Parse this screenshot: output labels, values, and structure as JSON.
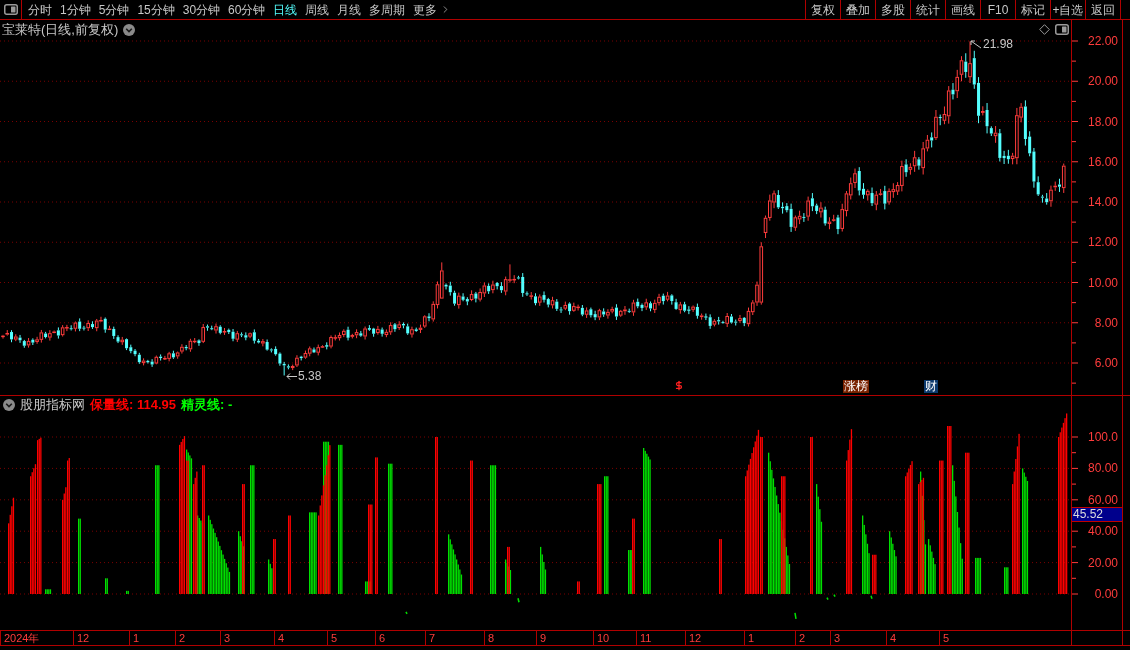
{
  "toolbar": {
    "periods": [
      {
        "label": "分时",
        "selected": false,
        "kind": "period"
      },
      {
        "label": "1分钟",
        "selected": false,
        "kind": "period"
      },
      {
        "label": "5分钟",
        "selected": false,
        "kind": "period"
      },
      {
        "label": "15分钟",
        "selected": false,
        "kind": "period"
      },
      {
        "label": "30分钟",
        "selected": false,
        "kind": "period"
      },
      {
        "label": "60分钟",
        "selected": false,
        "kind": "period"
      },
      {
        "label": "日线",
        "selected": true,
        "kind": "period"
      },
      {
        "label": "周线",
        "selected": false,
        "kind": "period"
      },
      {
        "label": "月线",
        "selected": false,
        "kind": "period"
      },
      {
        "label": "多周期",
        "selected": false,
        "kind": "period"
      },
      {
        "label": "更多",
        "selected": false,
        "kind": "menu"
      }
    ],
    "actions": [
      "复权",
      "叠加",
      "多股",
      "统计",
      "画线",
      "F10",
      "标记",
      "+自选",
      "返回"
    ]
  },
  "main_chart": {
    "title": "宝莱特(日线,前复权)",
    "high_label": "21.98",
    "low_label": "5.38",
    "event_markers": [
      {
        "kind": "icon"
      },
      {
        "kind": "tag",
        "label": "涨榜",
        "color": "#7a2200"
      },
      {
        "kind": "tag",
        "label": "财",
        "color": "#0c3a6e"
      }
    ],
    "price_axis": [
      "22.00",
      "20.00",
      "18.00",
      "16.00",
      "14.00",
      "12.00",
      "10.00",
      "8.00",
      "6.00"
    ]
  },
  "indicator": {
    "title": "股朋指标网",
    "lines": [
      {
        "text": "保量线: 114.95",
        "color": "#ff0000"
      },
      {
        "text": "精灵线: -",
        "color": "#00ff00"
      }
    ],
    "axis": [
      "100.0",
      "80.00",
      "60.00",
      "40.00",
      "20.00",
      "0.00"
    ],
    "current_value": "45.52"
  },
  "date_axis": [
    "2024年",
    "12",
    "1",
    "2",
    "3",
    "4",
    "5",
    "6",
    "7",
    "8",
    "9",
    "10",
    "11",
    "12",
    "1",
    "2",
    "3",
    "4",
    "5"
  ]
}
